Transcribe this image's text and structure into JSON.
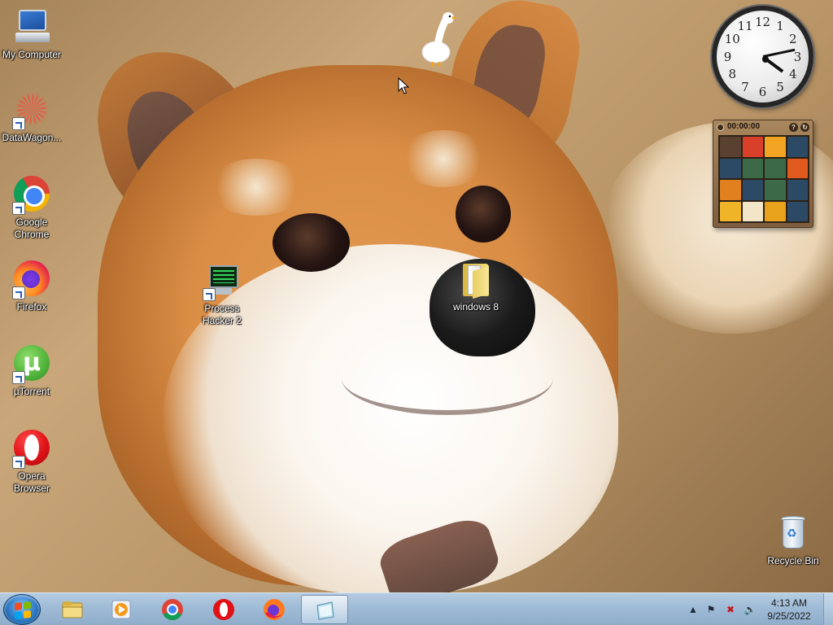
{
  "desktop": {
    "icons": [
      {
        "id": "my-computer",
        "label": "My Computer"
      },
      {
        "id": "datawagon",
        "label": "DataWagon..."
      },
      {
        "id": "google-chrome",
        "label": "Google Chrome"
      },
      {
        "id": "firefox",
        "label": "Firefox"
      },
      {
        "id": "utorrent",
        "label": "µTorrent"
      },
      {
        "id": "opera",
        "label": "Opera Browser"
      },
      {
        "id": "process-hacker",
        "label": "Process Hacker 2"
      },
      {
        "id": "windows-8-folder",
        "label": "windows 8"
      },
      {
        "id": "recycle-bin",
        "label": "Recycle Bin"
      }
    ]
  },
  "clock_gadget": {
    "numerals": [
      "12",
      "1",
      "2",
      "3",
      "4",
      "5",
      "6",
      "7",
      "8",
      "9",
      "10",
      "11"
    ],
    "time": {
      "hour": 4,
      "minute": 13
    }
  },
  "puzzle_gadget": {
    "timer": "00:00:00",
    "help_label": "?",
    "shuffle_label": "↻",
    "tile_colors": [
      "#5a4030",
      "#d8402a",
      "#f2a422",
      "#2c4a66",
      "#2c4a66",
      "#3c6a48",
      "#3c6a48",
      "#e05a1e",
      "#e0801e",
      "#2c4a66",
      "#3c6a48",
      "#2c4a66",
      "#f0b428",
      "#f3e6c8",
      "#e8a21c",
      "#2c4a66"
    ]
  },
  "taskbar": {
    "pinned": [
      {
        "id": "explorer",
        "icon": "folder-icon"
      },
      {
        "id": "media-player",
        "icon": "media-player-icon"
      },
      {
        "id": "chrome",
        "icon": "chrome-icon"
      },
      {
        "id": "opera",
        "icon": "opera-icon"
      },
      {
        "id": "firefox",
        "icon": "firefox-icon"
      },
      {
        "id": "active-window",
        "icon": "window-icon"
      }
    ],
    "tray": {
      "time": "4:13 AM",
      "date": "9/25/2022"
    }
  },
  "colors": {
    "taskbar": "#9fbbd6",
    "label_text": "#ffffff"
  }
}
